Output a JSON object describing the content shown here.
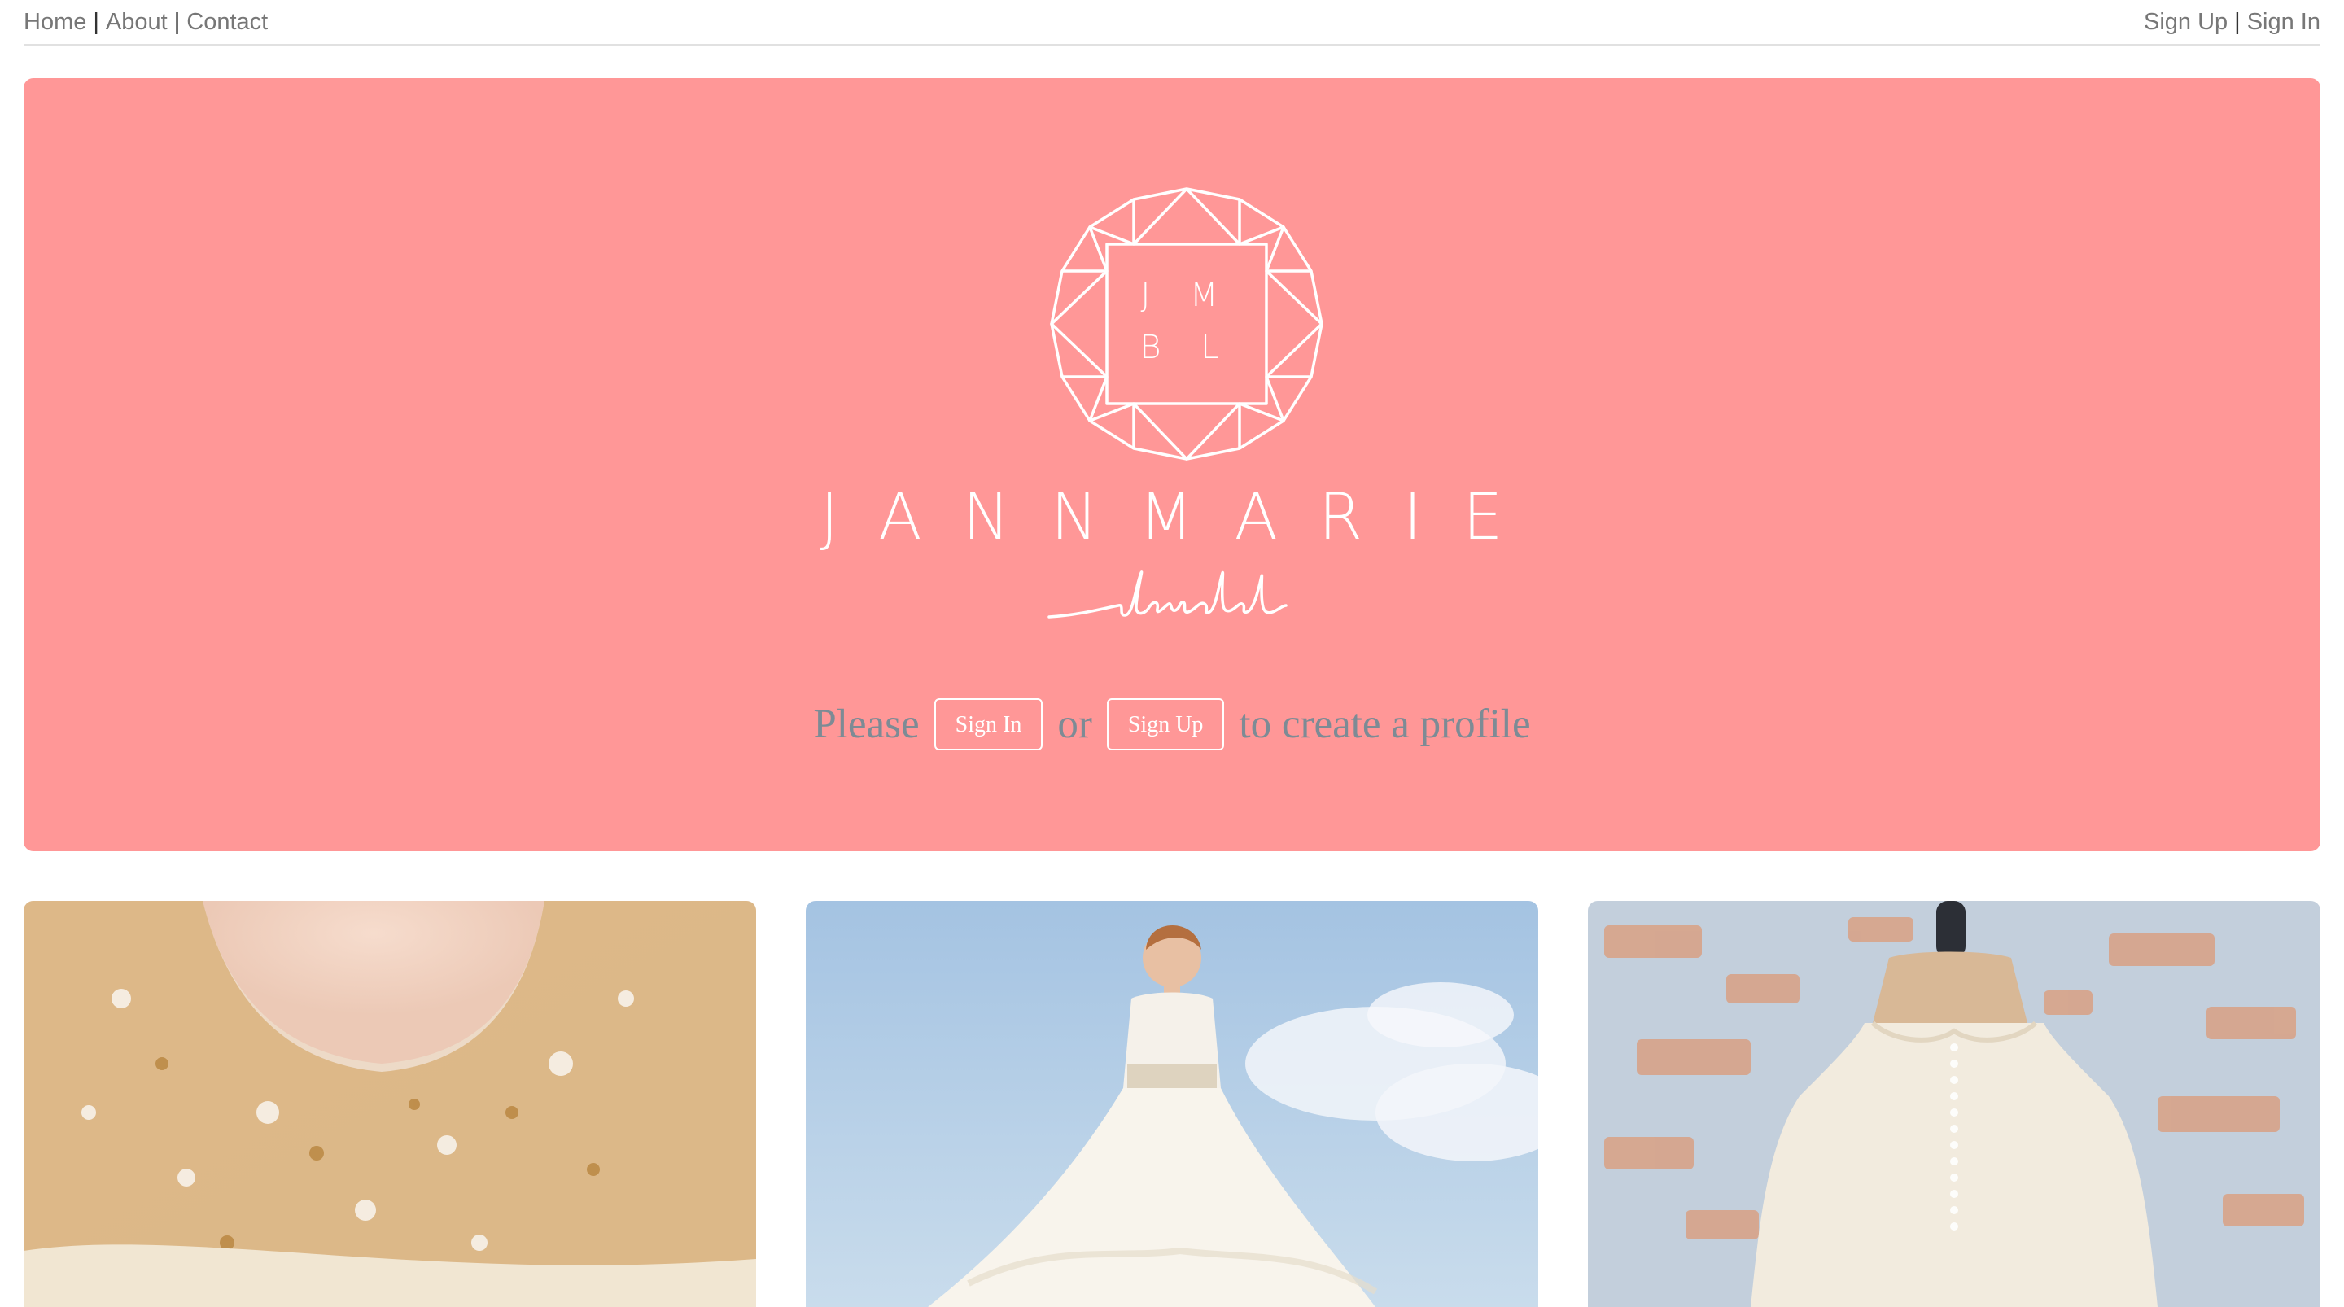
{
  "nav": {
    "left": [
      {
        "label": "Home"
      },
      {
        "label": "About"
      },
      {
        "label": "Contact"
      }
    ],
    "right": [
      {
        "label": "Sign Up"
      },
      {
        "label": "Sign In"
      }
    ],
    "separator": "|"
  },
  "hero": {
    "background": "#ff9797",
    "logo": {
      "icon": "diamond-monogram-icon",
      "monogram_top": "J M",
      "monogram_bottom": "B L",
      "brand_name": "JANNMARIE",
      "brand_sub": "bridal"
    },
    "cta": {
      "prefix": "Please",
      "sign_in_label": "Sign In",
      "middle": "or",
      "sign_up_label": "Sign Up",
      "suffix": "to create a profile"
    }
  },
  "gallery": [
    {
      "image": "beaded-gold-bodice-photo"
    },
    {
      "image": "bride-in-white-dress-sky-photo"
    },
    {
      "image": "lace-dress-on-mannequin-photo"
    }
  ]
}
